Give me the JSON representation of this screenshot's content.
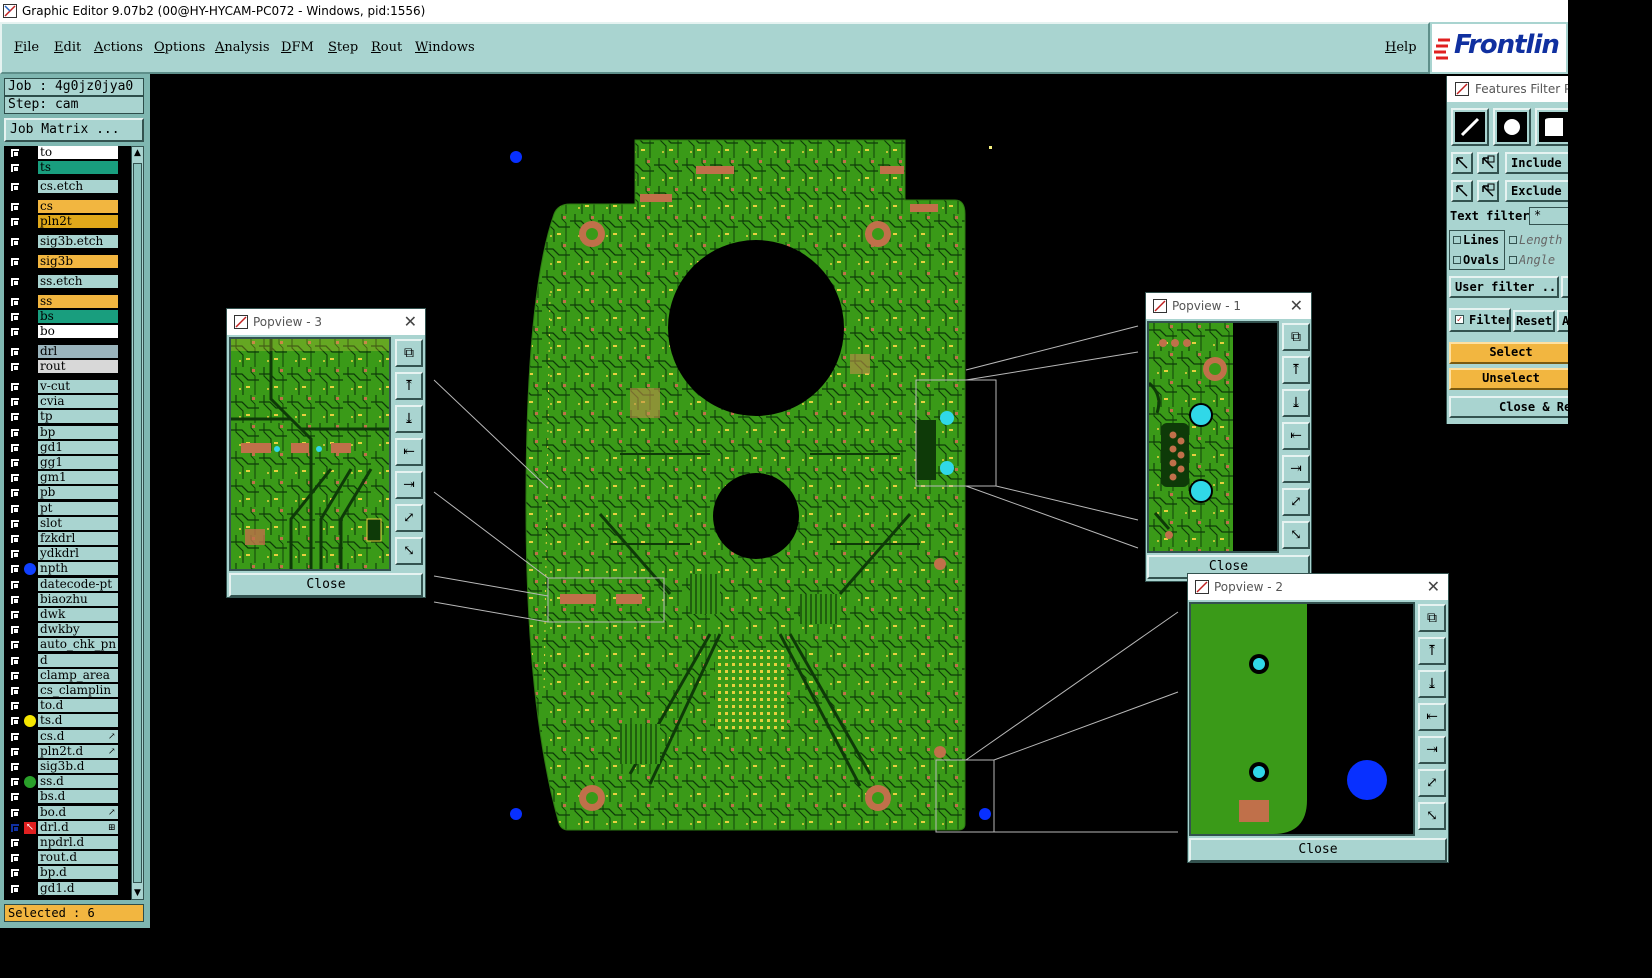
{
  "window": {
    "title": "Graphic Editor 9.07b2 (00@HY-HYCAM-PC072 - Windows, pid:1556)"
  },
  "menu": {
    "items": [
      "File",
      "Edit",
      "Actions",
      "Options",
      "Analysis",
      "DFM",
      "Step",
      "Rout",
      "Windows"
    ],
    "help": "Help"
  },
  "logo": {
    "text": "Frontlin"
  },
  "left_panel": {
    "job": "Job : 4g0jz0jya0",
    "step": "Step: cam",
    "job_matrix": "Job Matrix ...",
    "selected": "Selected : 6",
    "layers": [
      {
        "name": "to",
        "color": "#ffffff"
      },
      {
        "name": "ts",
        "color": "#199e7e"
      },
      {
        "name": "cs.etch",
        "color": "#a9d4d0"
      },
      {
        "name": "cs",
        "color": "#f2b640"
      },
      {
        "name": "pln2t",
        "color": "#e0a81a"
      },
      {
        "name": "sig3b.etch",
        "color": "#a9d4d0"
      },
      {
        "name": "sig3b",
        "color": "#f2b640"
      },
      {
        "name": "ss.etch",
        "color": "#a9d4d0"
      },
      {
        "name": "ss",
        "color": "#f2b640"
      },
      {
        "name": "bs",
        "color": "#199e7e"
      },
      {
        "name": "bo",
        "color": "#ffffff"
      },
      {
        "name": "drl",
        "color": "#9ab4bc"
      },
      {
        "name": "rout",
        "color": "#d8d8d8"
      },
      {
        "name": "v-cut",
        "color": "#a9d4d0"
      },
      {
        "name": "cvia",
        "color": "#a9d4d0"
      },
      {
        "name": "tp",
        "color": "#a9d4d0"
      },
      {
        "name": "bp",
        "color": "#a9d4d0"
      },
      {
        "name": "gd1",
        "color": "#a9d4d0"
      },
      {
        "name": "gg1",
        "color": "#a9d4d0"
      },
      {
        "name": "gm1",
        "color": "#a9d4d0"
      },
      {
        "name": "pb",
        "color": "#a9d4d0"
      },
      {
        "name": "pt",
        "color": "#a9d4d0"
      },
      {
        "name": "slot",
        "color": "#a9d4d0"
      },
      {
        "name": "fzkdrl",
        "color": "#a9d4d0"
      },
      {
        "name": "ydkdrl",
        "color": "#a9d4d0"
      },
      {
        "name": "npth",
        "color": "#a9d4d0",
        "dot": "#1040ff"
      },
      {
        "name": "datecode-pt",
        "color": "#a9d4d0"
      },
      {
        "name": "biaozhu",
        "color": "#a9d4d0"
      },
      {
        "name": "dwk",
        "color": "#a9d4d0"
      },
      {
        "name": "dwkby",
        "color": "#a9d4d0"
      },
      {
        "name": "auto_chk_pn",
        "color": "#a9d4d0"
      },
      {
        "name": "d",
        "color": "#a9d4d0"
      },
      {
        "name": "clamp_area",
        "color": "#a9d4d0"
      },
      {
        "name": "cs_clamplin",
        "color": "#a9d4d0"
      },
      {
        "name": "to.d",
        "color": "#a9d4d0"
      },
      {
        "name": "ts.d",
        "color": "#a9d4d0",
        "dot": "#f5e600"
      },
      {
        "name": "cs.d",
        "color": "#a9d4d0",
        "flag": "↗"
      },
      {
        "name": "pln2t.d",
        "color": "#a9d4d0",
        "flag": "↗"
      },
      {
        "name": "sig3b.d",
        "color": "#a9d4d0"
      },
      {
        "name": "ss.d",
        "color": "#a9d4d0",
        "dot": "#2aa02a"
      },
      {
        "name": "bs.d",
        "color": "#a9d4d0"
      },
      {
        "name": "bo.d",
        "color": "#a9d4d0",
        "flag": "↗"
      },
      {
        "name": "drl.d",
        "color": "#a9d4d0",
        "flag": "⊞",
        "active": true
      },
      {
        "name": "npdrl.d",
        "color": "#a9d4d0"
      },
      {
        "name": "rout.d",
        "color": "#a9d4d0"
      },
      {
        "name": "bp.d",
        "color": "#a9d4d0"
      },
      {
        "name": "gd1.d",
        "color": "#a9d4d0"
      }
    ]
  },
  "popviews": {
    "p3": {
      "title": "Popview - 3",
      "close": "Close"
    },
    "p1": {
      "title": "Popview - 1",
      "close": "Close"
    },
    "p2": {
      "title": "Popview - 2",
      "close": "Close"
    }
  },
  "filter": {
    "title": "Features Filter Po",
    "include": "Include S",
    "exclude": "Exclude S",
    "text_filter_label": "Text filter",
    "text_filter_value": "*",
    "lines": "Lines",
    "ovals": "Ovals",
    "length": "Length",
    "angle": "Angle",
    "user_filter": "User filter ...",
    "filter": "Filter",
    "reset": "Reset",
    "select": "Select",
    "unselect": "Unselect",
    "close_reset": "Close & Res"
  },
  "colors": {
    "board": "#3a9a18",
    "pad": "#c0704a",
    "trace": "#0e3a08",
    "yellow": "#e8d040",
    "cyan": "#30d8e8",
    "blue": "#0830ff"
  }
}
